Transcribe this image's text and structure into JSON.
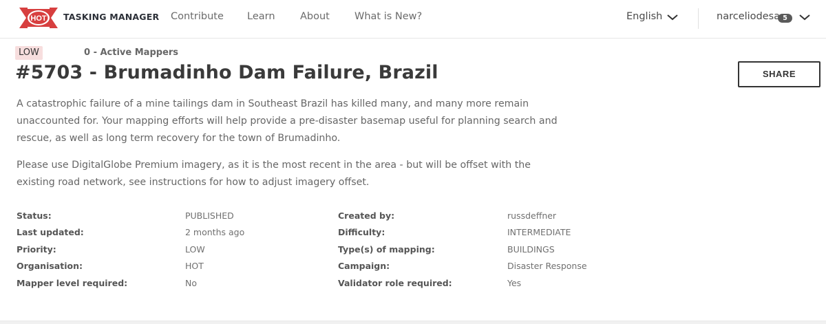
{
  "header": {
    "logo_text": "HOT",
    "brand": "TASKING MANAGER",
    "nav": [
      "Contribute",
      "Learn",
      "About",
      "What is New?"
    ],
    "language": "English",
    "username": "narceliodesa",
    "notification_count": "5",
    "colors": {
      "logo_red": "#d73f3f"
    }
  },
  "project": {
    "priority_badge": "LOW",
    "active_mappers": "0 - Active Mappers",
    "title": "#5703 - Brumadinho Dam Failure, Brazil",
    "share_label": "SHARE",
    "description": [
      "A catastrophic failure of a mine tailings dam in Southeast Brazil has killed many, and many more remain unaccounted for. Your mapping efforts will help provide a pre-disaster basemap useful for planning search and rescue, as well as long term recovery for the town of Brumadinho.",
      "Please use DigitalGlobe Premium imagery, as it is the most recent in the area - but will be offset with the existing road network, see instructions for how to adjust imagery offset."
    ]
  },
  "details": {
    "rows": [
      {
        "k1": "Status:",
        "v1": "PUBLISHED",
        "k2": "Created by:",
        "v2": "russdeffner"
      },
      {
        "k1": "Last updated:",
        "v1": "2 months ago",
        "k2": "Difficulty:",
        "v2": "INTERMEDIATE"
      },
      {
        "k1": "Priority:",
        "v1": "LOW",
        "k2": "Type(s) of mapping:",
        "v2": "BUILDINGS"
      },
      {
        "k1": "Organisation:",
        "v1": "HOT",
        "k2": "Campaign:",
        "v2": "Disaster Response"
      },
      {
        "k1": "Mapper level required:",
        "v1": "No",
        "k2": "Validator role required:",
        "v2": "Yes"
      }
    ]
  }
}
